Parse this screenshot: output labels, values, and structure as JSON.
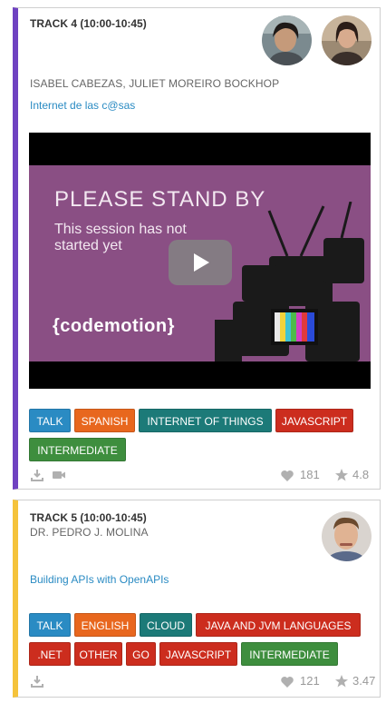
{
  "sessions": [
    {
      "track": "TRACK 4 (10:00-10:45)",
      "speakers": "ISABEL CABEZAS, JULIET MOREIRO BOCKHOP",
      "title": "Internet de las c@sas",
      "video": {
        "headline": "PLEASE STAND BY",
        "subtext": "This session has not started yet",
        "logo": "{codemotion}"
      },
      "tags": [
        "TALK",
        "SPANISH",
        "INTERNET OF THINGS",
        "JAVASCRIPT",
        "INTERMEDIATE"
      ],
      "likes": "181",
      "rating": "4.8",
      "accent": "#6f42c1"
    },
    {
      "track": "TRACK 5 (10:00-10:45)",
      "speakers": "DR. PEDRO J. MOLINA",
      "title": "Building APIs with OpenAPIs",
      "tags": [
        "TALK",
        "ENGLISH",
        "CLOUD",
        "JAVA AND JVM LANGUAGES",
        ".NET",
        "OTHER",
        "GO",
        "JAVASCRIPT",
        "INTERMEDIATE"
      ],
      "likes": "121",
      "rating": "3.47",
      "accent": "#f5c33b"
    }
  ],
  "colors": {
    "talk": "#2a8bc3",
    "language": "#e8671e",
    "topic": "#1c7a78",
    "tech": "#cc2d1e",
    "level": "#3e8e3e"
  },
  "icons": [
    "download-icon",
    "video-camera-icon",
    "heart-icon",
    "star-icon",
    "play-icon"
  ]
}
